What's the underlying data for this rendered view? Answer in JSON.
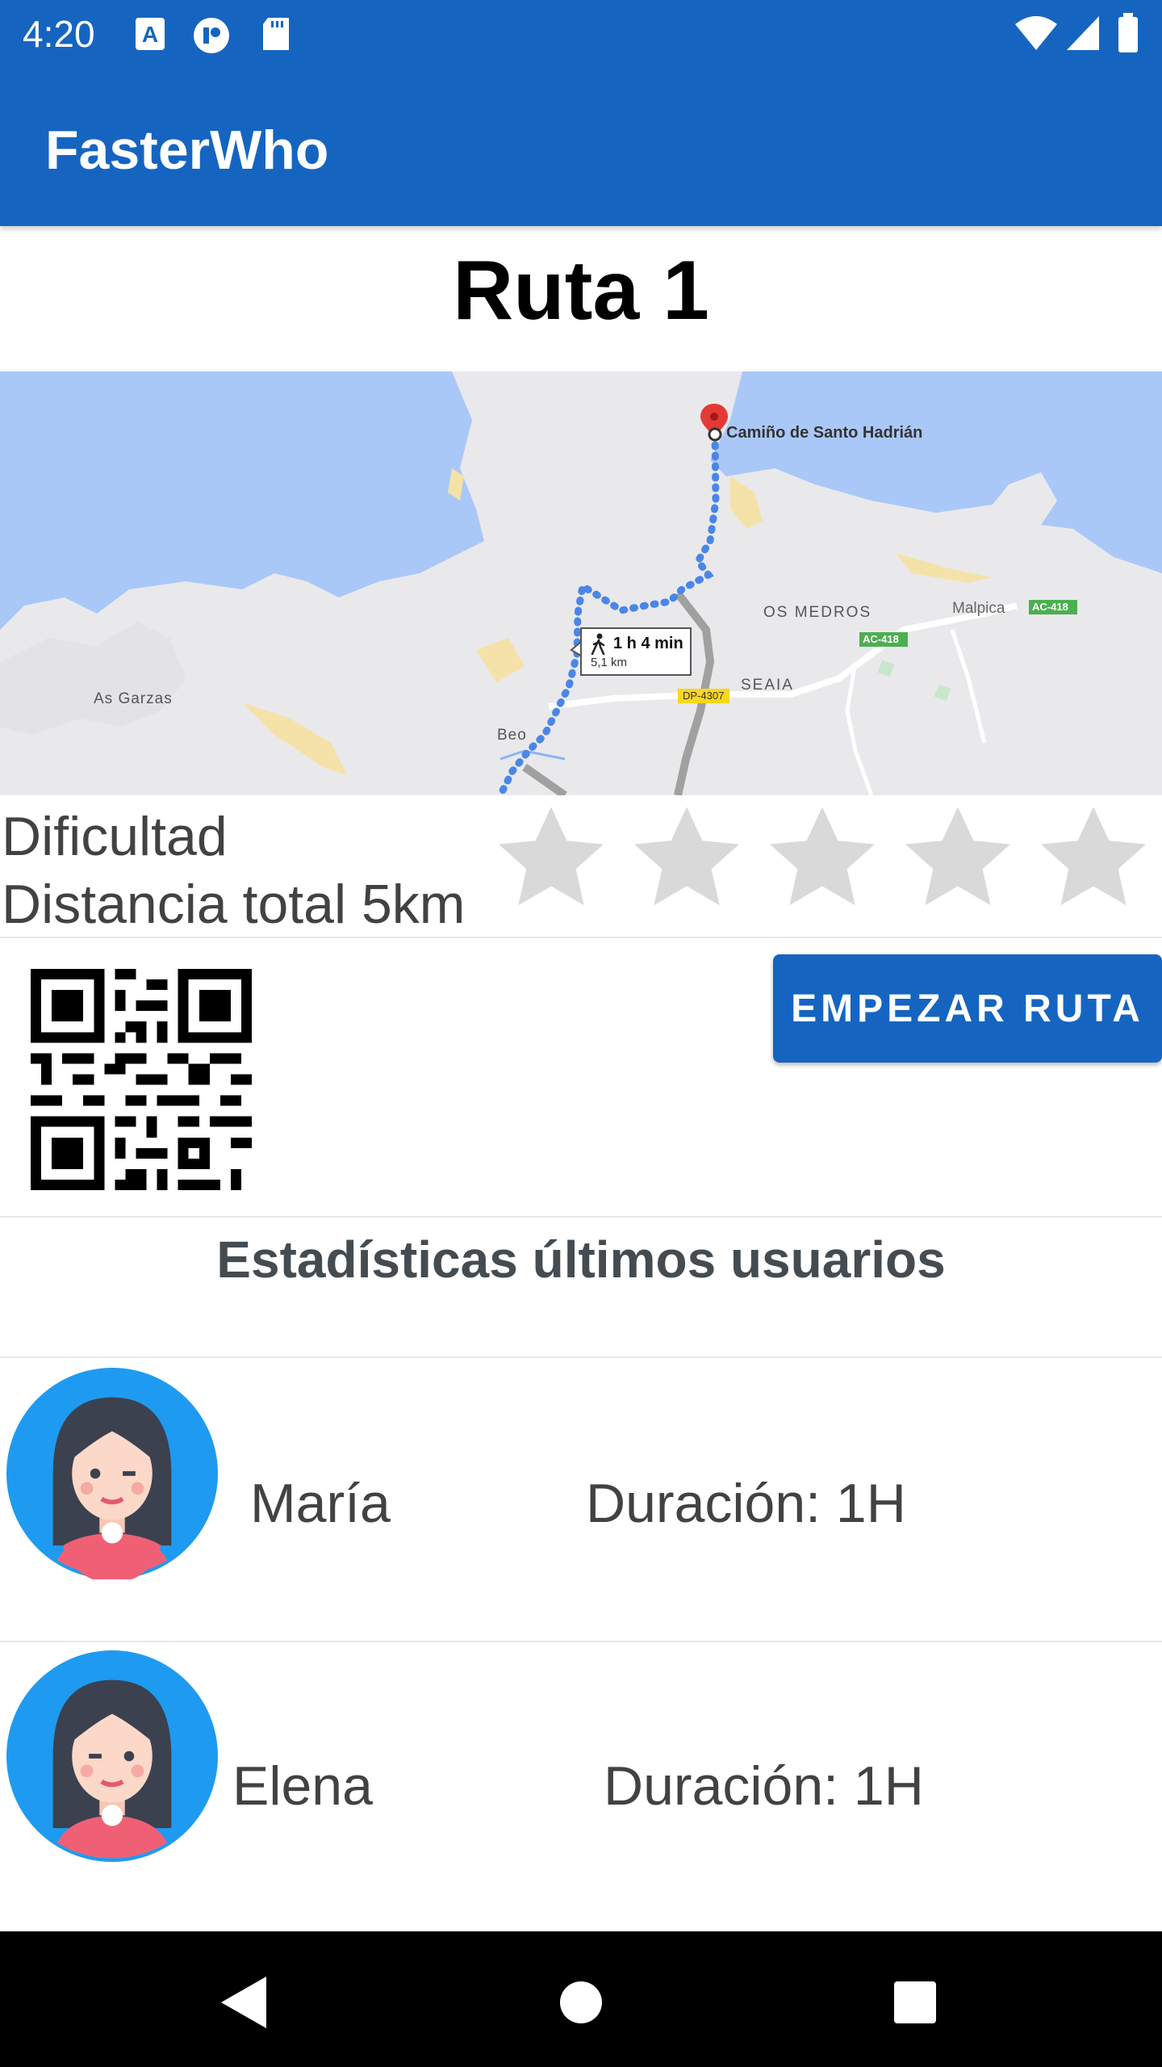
{
  "status_bar": {
    "time": "4:20"
  },
  "app_bar": {
    "title": "FasterWho"
  },
  "route": {
    "title": "Ruta 1",
    "difficulty_label": "Dificultad",
    "distance_label": "Distancia total 5km",
    "difficulty_rating": 0,
    "difficulty_max": 5
  },
  "map": {
    "place_label": "Camiño de Santo Hadrián",
    "trip_time": "1 h 4 min",
    "trip_distance": "5,1 km",
    "labels": {
      "os_medros": "OS MEDROS",
      "malpica": "Malpica",
      "seaia": "SEAIA",
      "as_garzas": "As Garzas",
      "beo": "Beo",
      "road_ac418_a": "AC-418",
      "road_ac418_b": "AC-418",
      "road_dp4307": "DP-4307"
    },
    "colors": {
      "water": "#aac8f7",
      "land": "#e9e9ec",
      "route": "#4a86e8",
      "pin": "#e53935"
    }
  },
  "actions": {
    "start_route": "EMPEZAR RUTA"
  },
  "stats": {
    "title": "Estadísticas últimos usuarios",
    "users": [
      {
        "name": "María",
        "duration": "Duración: 1H"
      },
      {
        "name": "Elena",
        "duration": "Duración: 1H"
      }
    ]
  },
  "colors": {
    "primary": "#1565c0",
    "star_empty": "#d9d9d9",
    "text": "#424242"
  }
}
